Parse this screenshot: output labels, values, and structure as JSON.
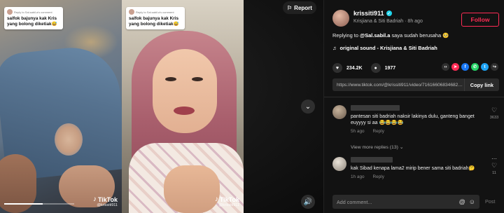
{
  "video": {
    "left_caption": {
      "reply_to": "Reply to Sal.sabil.a's comment",
      "text": "salfok bajunya kak Kris yang bolong diketiak😅"
    },
    "right_caption": {
      "reply_to": "Reply to Sal.sabil.a's comment",
      "text": "salfok bajunya kak Kris yang bolong diketiak😅"
    },
    "watermark": "TikTok",
    "watermark_handle": "@krissiti911",
    "report_label": "Report",
    "progress_fraction": 0.55
  },
  "panel": {
    "username": "krissiti911",
    "meta": "Krisjiana & Siti Badriah · 8h ago",
    "follow_label": "Follow",
    "description_prefix": "Replying to ",
    "description_mention": "@Sal.sabil.a",
    "description_text": " saya sudah berusaha 🥺",
    "sound_icon": "♫",
    "sound": "original sound - Krisjiana & Siti Badriah",
    "likes": "234.2K",
    "comments": "1977",
    "link_url": "https://www.tiktok.com/@krissiti911/video/7161660683468200000",
    "copy_link_label": "Copy link"
  },
  "share_colors": {
    "embed": "#2f2f2f",
    "direct": "#fe2c55",
    "facebook": "#1877f2",
    "whatsapp": "#25d366",
    "twitter": "#1da1f2",
    "more": "#2f2f2f"
  },
  "comments": [
    {
      "text": "pantesan siti badriah naksir lakinya dulu, ganteng banget euyyyy si aa 😂😂😂😂",
      "time": "5h ago",
      "reply": "Reply",
      "likes": "3633"
    },
    {
      "text": "kak Sibad kenapa lama2 mirip bener sama siti badriah🤔",
      "time": "1h ago",
      "reply": "Reply",
      "likes": "11"
    }
  ],
  "more_replies": "View more replies (13) ⌄",
  "comment_input": {
    "placeholder": "Add comment..."
  },
  "post_label": "Post"
}
